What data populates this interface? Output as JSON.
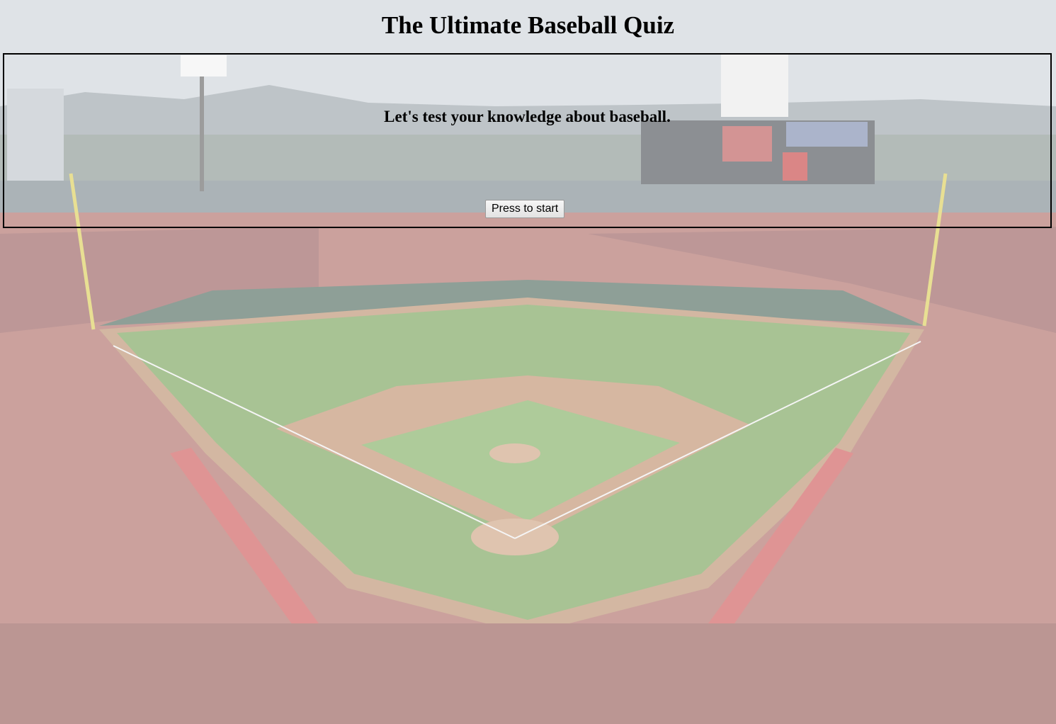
{
  "page": {
    "title": "The Ultimate Baseball Quiz"
  },
  "intro": {
    "text": "Let's test your knowledge about baseball.",
    "start_label": "Press to start"
  },
  "colors": {
    "text": "#000000",
    "panel_border": "#000000",
    "field_grass": "#6f9a4c",
    "field_dirt": "#b98660",
    "crowd": "#a45a52",
    "sky": "#c7ced6"
  }
}
